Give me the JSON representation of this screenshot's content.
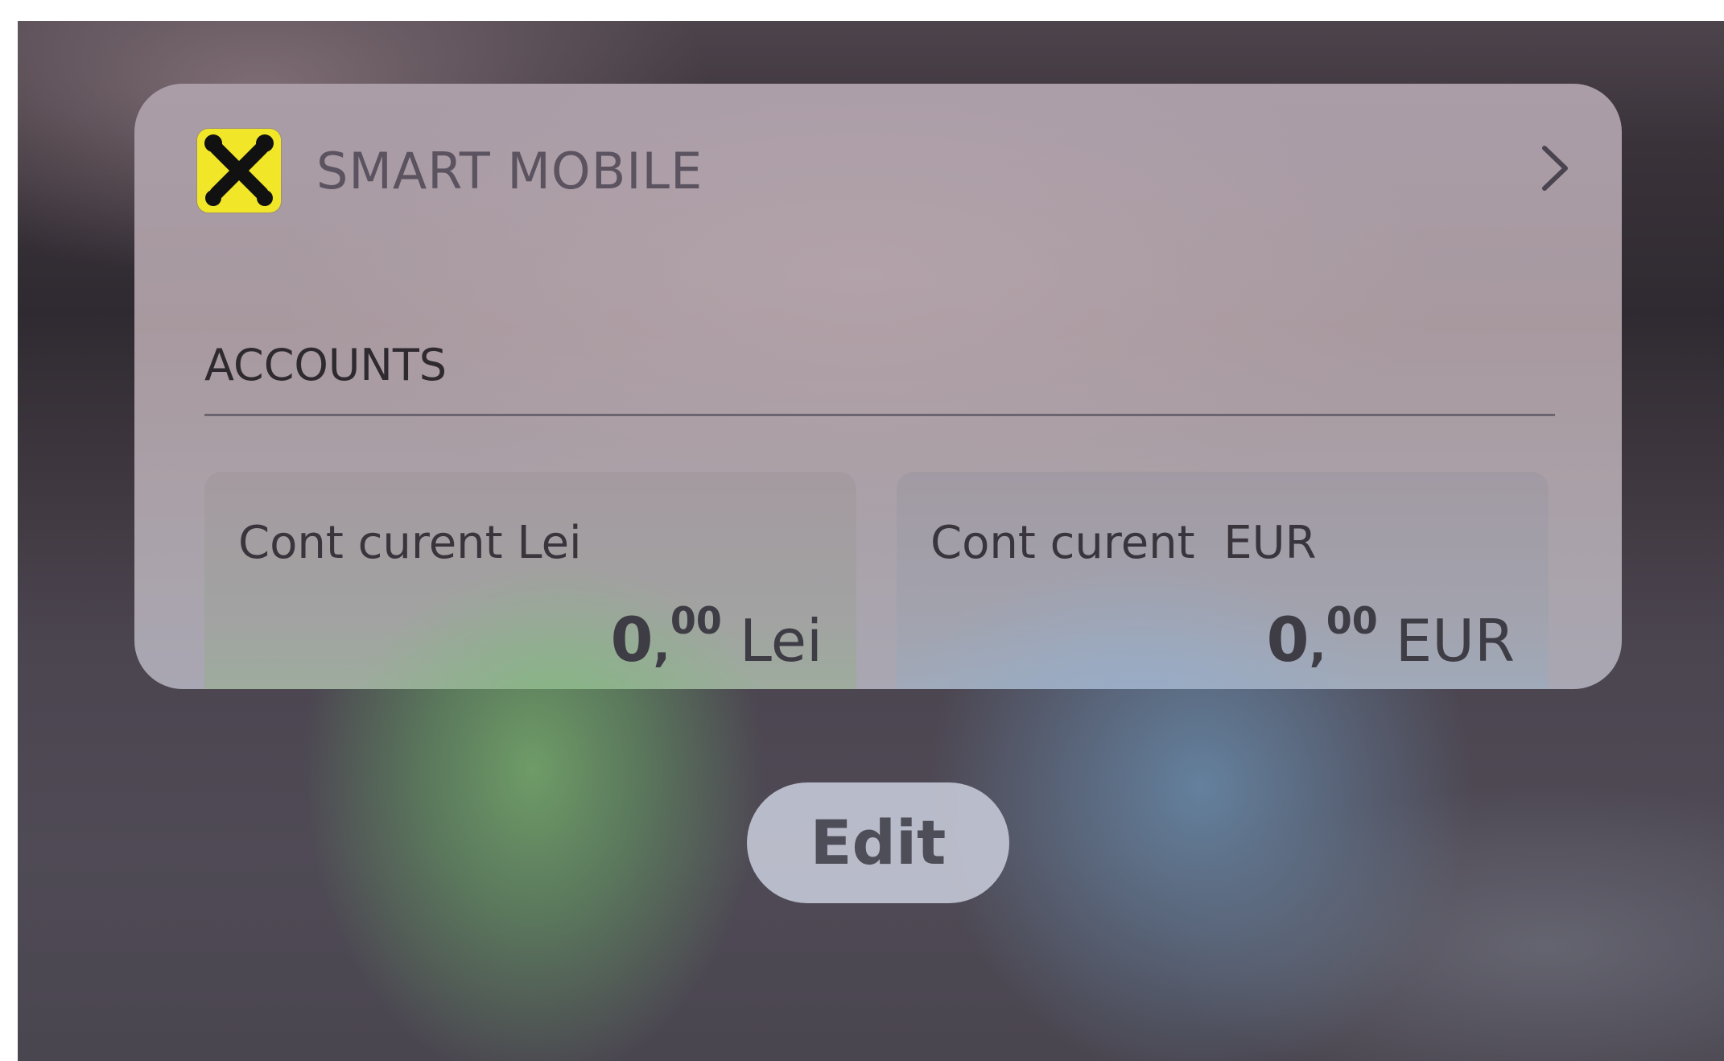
{
  "widget": {
    "app_name": "SMART MOBILE",
    "logo_icon": "raiffeisen-x-logo",
    "chevron_icon": "chevron-right-icon",
    "brand_color": "#f2e629",
    "section_title": "ACCOUNTS",
    "accounts": [
      {
        "name": "Cont curent Lei",
        "balance_integer": "0",
        "balance_separator": ",",
        "balance_decimal": "00",
        "currency": "Lei"
      },
      {
        "name": "Cont curent  EUR",
        "balance_integer": "0",
        "balance_separator": ",",
        "balance_decimal": "00",
        "currency": "EUR"
      }
    ]
  },
  "edit_button": {
    "label": "Edit"
  }
}
